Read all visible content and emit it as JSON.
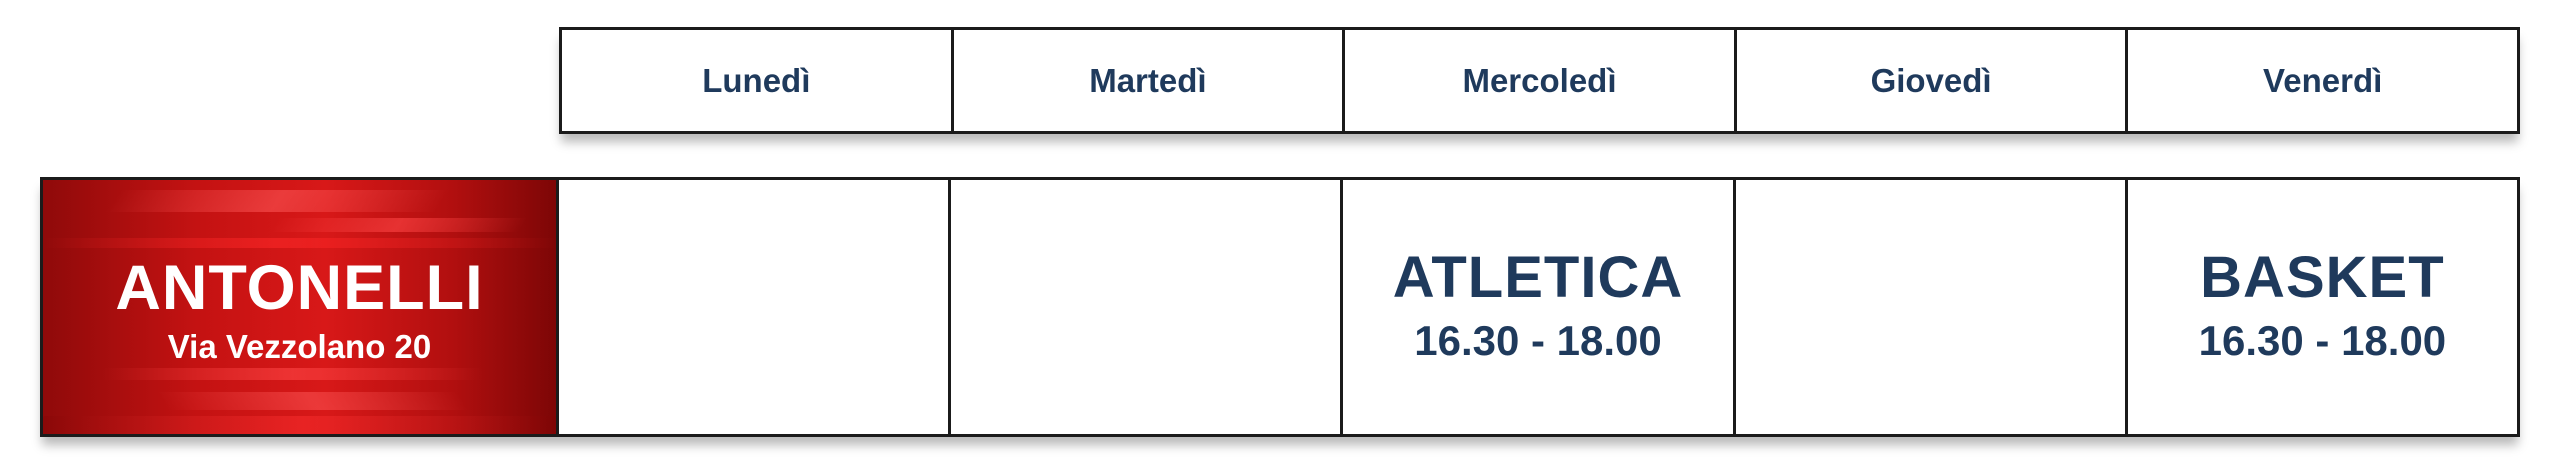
{
  "days": [
    "Lunedì",
    "Martedì",
    "Mercoledì",
    "Giovedì",
    "Venerdì"
  ],
  "school": {
    "name": "ANTONELLI",
    "address": "Via Vezzolano 20"
  },
  "schedule": [
    {
      "activity": "",
      "time": ""
    },
    {
      "activity": "",
      "time": ""
    },
    {
      "activity": "ATLETICA",
      "time": "16.30 - 18.00"
    },
    {
      "activity": "",
      "time": ""
    },
    {
      "activity": "BASKET",
      "time": "16.30 - 18.00"
    }
  ],
  "colors": {
    "text_primary": "#1f3a5c",
    "banner_red": "#c41212",
    "border": "#1b1b1b"
  }
}
